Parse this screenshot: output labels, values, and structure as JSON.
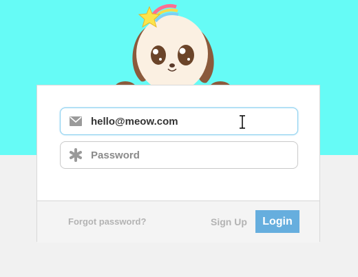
{
  "theme": {
    "top_background": "#66fbf6",
    "page_background": "#f1f1f1",
    "accent": "#66aede",
    "focus_border": "#8ad0f0",
    "muted_text": "#b3b3b3"
  },
  "mascot": {
    "icon": "puppy-mascot-with-star-icon"
  },
  "login_form": {
    "email": {
      "icon": "envelope-icon",
      "value": "hello@meow.com",
      "focused": true
    },
    "password": {
      "icon": "asterisk-icon",
      "placeholder": "Password",
      "value": ""
    }
  },
  "footer": {
    "forgot_password_label": "Forgot password?",
    "signup_label": "Sign Up",
    "login_label": "Login"
  }
}
